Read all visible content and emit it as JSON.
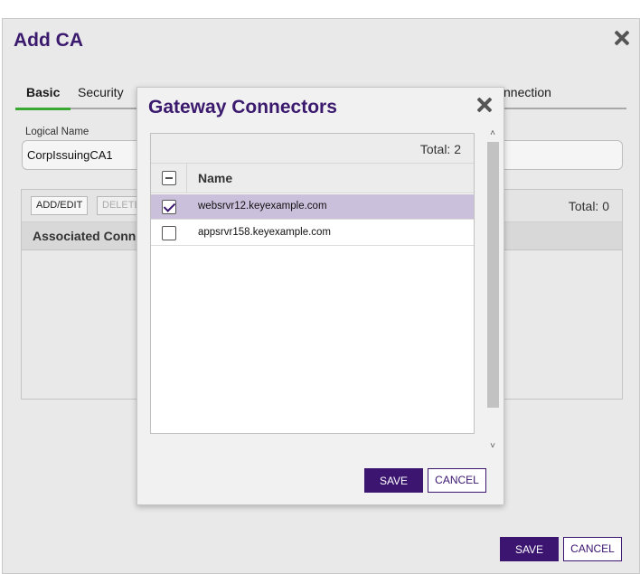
{
  "outer_dialog": {
    "title": "Add CA",
    "tabs": [
      "Basic",
      "Security",
      "nnection"
    ],
    "logical_name_label": "Logical Name",
    "logical_name_value": "CorpIssuingCA1",
    "toolbar": {
      "add_edit": "ADD/EDIT",
      "delete": "DELETE",
      "total": "Total: 0"
    },
    "grid_header": "Associated Connec",
    "save": "SAVE",
    "cancel": "CANCEL"
  },
  "modal": {
    "title": "Gateway Connectors",
    "total": "Total: 2",
    "column_name": "Name",
    "rows": [
      {
        "name": "websrvr12.keyexample.com",
        "checked": true
      },
      {
        "name": "appsrvr158.keyexample.com",
        "checked": false
      }
    ],
    "save": "SAVE",
    "cancel": "CANCEL"
  },
  "colors": {
    "accent": "#3b1570",
    "title": "#3b1a6e",
    "selected_row": "#cbc0dc",
    "active_tab": "#38a832"
  }
}
